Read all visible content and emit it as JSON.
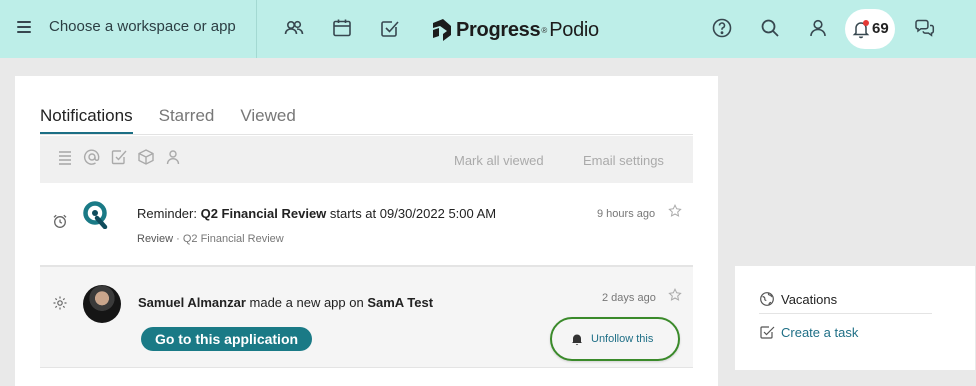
{
  "topbar": {
    "workspace_label": "Choose a workspace or app",
    "logo_brand": "Progress",
    "logo_product": "Podio",
    "logo_mark": "®",
    "notifications_count": "69",
    "icons": [
      "menu-icon",
      "contacts-icon",
      "calendar-icon",
      "tasks-icon",
      "help-icon",
      "search-icon",
      "profile-icon",
      "bell-icon",
      "chat-icon"
    ]
  },
  "tabs": [
    {
      "label": "Notifications",
      "active": true
    },
    {
      "label": "Starred",
      "active": false
    },
    {
      "label": "Viewed",
      "active": false
    }
  ],
  "filterbar": {
    "icons": [
      "list-icon",
      "mention-icon",
      "task-check-icon",
      "app-cube-icon",
      "person-icon"
    ],
    "mark_all_label": "Mark all viewed",
    "email_settings_label": "Email settings"
  },
  "notifications": [
    {
      "icon": "alarm-clock-icon",
      "prefix": "Reminder: ",
      "title": "Q2 Financial Review",
      "middle": " starts at ",
      "datetime": "09/30/2022 5:00 AM",
      "sub_app": "Review",
      "sub_sep": " · ",
      "sub_item": "Q2 Financial Review",
      "time": "9 hours ago"
    },
    {
      "icon": "gear-icon",
      "actor": "Samuel Almanzar",
      "middle": " made a new app on ",
      "space": "SamA Test",
      "time": "2 days ago",
      "button_label": "Go to this application",
      "unfollow_label": "Unfollow this"
    }
  ],
  "side": {
    "title": "Vacations",
    "link": "Create a task"
  },
  "colors": {
    "topbar_bg": "#bdeee8",
    "accent": "#1a7a86",
    "link": "#1f6f86",
    "highlight_ring": "#3a8a2a",
    "badge_dot": "#e53935"
  }
}
